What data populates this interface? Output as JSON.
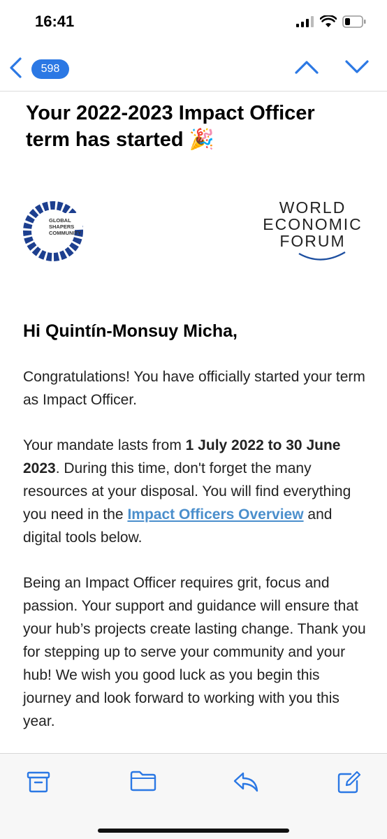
{
  "status": {
    "time": "16:41"
  },
  "nav": {
    "unread_count": "598"
  },
  "email": {
    "subject": "Your 2022-2023 Impact Officer term has started 🎉",
    "logos": {
      "global_shapers": [
        "GLOBAL",
        "SHAPERS",
        "COMMUNITY"
      ],
      "wef": [
        "WORLD",
        "ECONOMIC",
        "FORUM"
      ]
    },
    "greeting": "Hi Quintín-Monsuy Micha,",
    "p1": "Congratulations! You have officially started your term as Impact Officer.",
    "p2": {
      "a": "Your mandate lasts from ",
      "bold": "1 July 2022 to 30 June 2023",
      "b": ". During this time, don't forget the many resources at your disposal. You will find everything you need in the ",
      "link": "Impact Officers Overview",
      "c": " and digital tools below."
    },
    "p3": "Being an Impact Officer requires grit, focus and passion. Your support and guidance will ensure that your hub’s projects create lasting change. Thank you for stepping up to serve your community and your hub! We wish you good luck as you begin this journey and look forward to working with you this year."
  },
  "toolbar": {
    "icons": [
      "archive-icon",
      "folder-icon",
      "reply-icon",
      "compose-icon"
    ]
  },
  "colors": {
    "accent": "#2b78e4",
    "link": "#4b8fcc",
    "logo_blue": "#1d3f8f"
  }
}
